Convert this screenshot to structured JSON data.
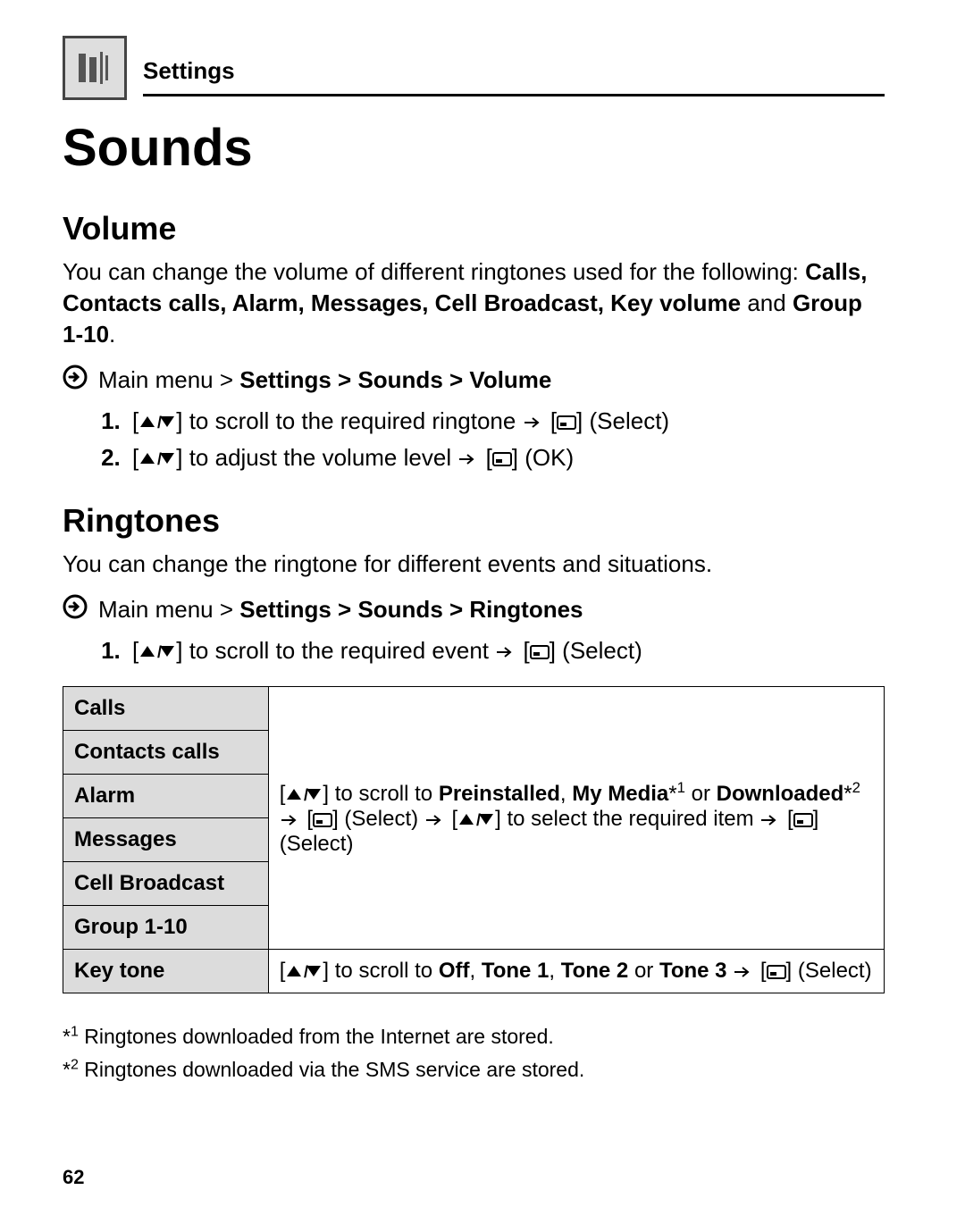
{
  "header": {
    "label": "Settings"
  },
  "title": "Sounds",
  "volume": {
    "heading": "Volume",
    "intro_lead": "You can change the volume of different ringtones used for the following: ",
    "intro_items": "Calls, Contacts calls, Alarm, Messages, Cell Broadcast, Key volume",
    "intro_and": " and ",
    "intro_last": "Group 1-10",
    "intro_period": ".",
    "nav_main": "Main menu > ",
    "nav_rest": "Settings > Sounds > Volume",
    "step1_mid": " to scroll to the required ringtone ",
    "step1_end": " (Select)",
    "step2_mid": " to adjust the volume level ",
    "step2_end": " (OK)"
  },
  "ringtones": {
    "heading": "Ringtones",
    "intro": "You can change the ringtone for different events and situations.",
    "nav_main": "Main menu > ",
    "nav_rest": "Settings > Sounds > Ringtones",
    "step1_mid": " to scroll to the required event ",
    "step1_end": " (Select)"
  },
  "table": {
    "rows": {
      "r0": "Calls",
      "r1": "Contacts calls",
      "r2": "Alarm",
      "r3": "Messages",
      "r4": "Cell Broadcast",
      "r5": "Group 1-10",
      "r6": "Key tone"
    },
    "cell_main_a": " to scroll to ",
    "cell_main_b": "Preinstalled",
    "cell_main_c": ", ",
    "cell_main_d": "My Media",
    "cell_main_e": " or ",
    "cell_main_f": "Downloaded",
    "cell_main_select1": " (Select) ",
    "cell_main_mid": " to select the required item ",
    "cell_main_select2": " (Select)",
    "cell_key_a": " to scroll to ",
    "cell_key_b": "Off",
    "cell_key_c": ", ",
    "cell_key_d": "Tone 1",
    "cell_key_e": ", ",
    "cell_key_f": "Tone 2",
    "cell_key_g": " or ",
    "cell_key_h": "Tone 3",
    "cell_key_select": " (Select)"
  },
  "footnotes": {
    "n1_mark": "*",
    "n1_sup": "1",
    "n1_text": " Ringtones downloaded from the Internet are stored.",
    "n2_mark": "*",
    "n2_sup": "2",
    "n2_text": " Ringtones downloaded via the SMS service are stored."
  },
  "page_number": "62"
}
